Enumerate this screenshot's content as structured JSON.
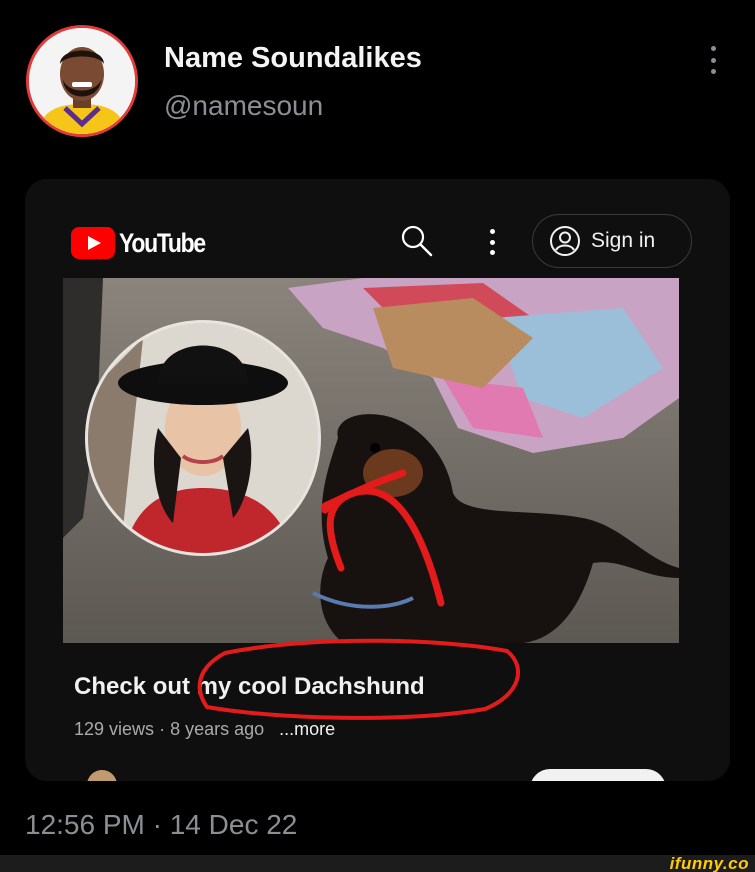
{
  "tweet": {
    "display_name": "Name Soundalikes",
    "handle": "@namesoun",
    "avatar_icon": "profile-photo",
    "timestamp": "12:56 PM · 14 Dec 22"
  },
  "youtube": {
    "logo_text": "YouTube",
    "sign_in_label": "Sign in",
    "video_title": "Check out my cool Dachshund",
    "views": "129 views",
    "age": "8 years ago",
    "more_label": "...more",
    "accent_color": "#ff0000"
  },
  "annotation_color": "#e31b1b",
  "watermark": "ifunny.co"
}
